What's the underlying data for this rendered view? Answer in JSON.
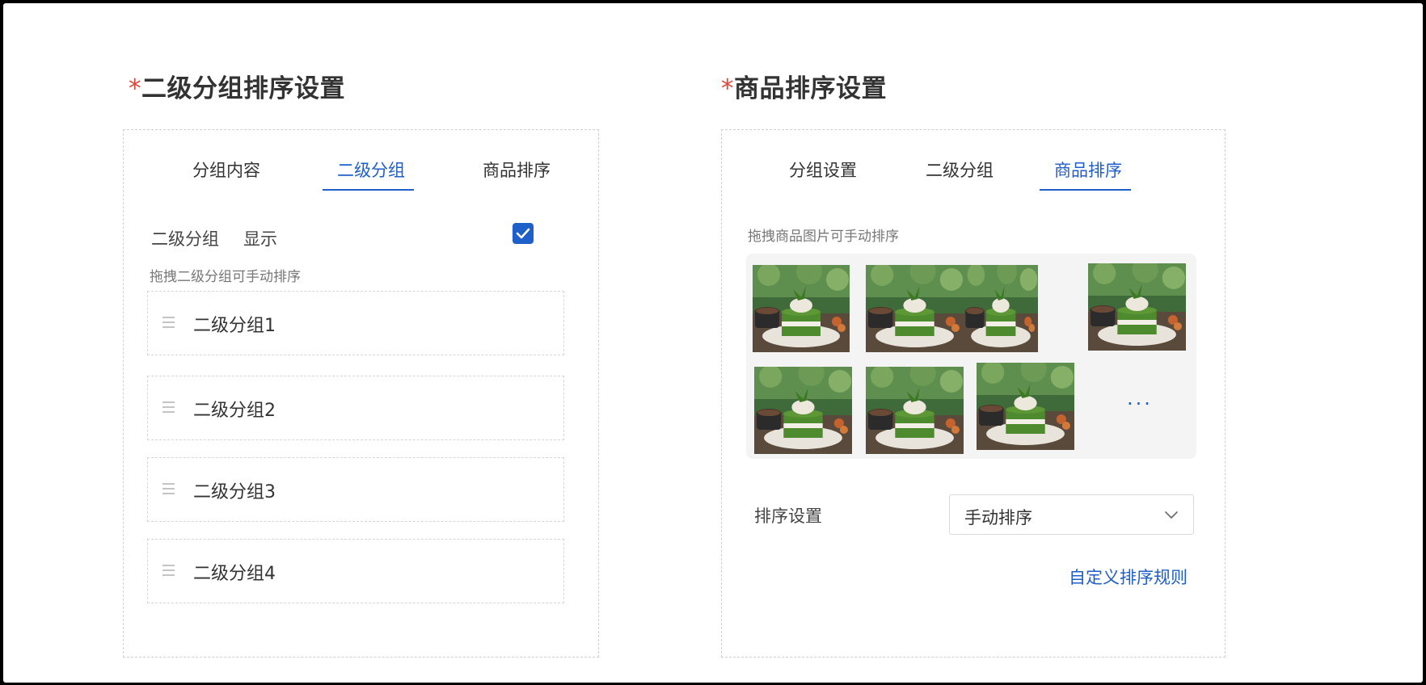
{
  "left_section": {
    "required_mark": "*",
    "title": "二级分组排序设置",
    "tabs": [
      {
        "label": "分组内容",
        "active": false
      },
      {
        "label": "二级分组",
        "active": true
      },
      {
        "label": "商品排序",
        "active": false
      }
    ],
    "display_row": {
      "group_label": "二级分组",
      "show_label": "显示",
      "checked": true
    },
    "hint": "拖拽二级分组可手动排序",
    "items": [
      "二级分组1",
      "二级分组2",
      "二级分组3",
      "二级分组4"
    ]
  },
  "right_section": {
    "required_mark": "*",
    "title": "商品排序设置",
    "tabs": [
      {
        "label": "分组设置",
        "active": false
      },
      {
        "label": "二级分组",
        "active": false
      },
      {
        "label": "商品排序",
        "active": true
      }
    ],
    "hint": "拖拽商品图片可手动排序",
    "more_label": "···",
    "sort_label": "排序设置",
    "sort_select": {
      "value": "手动排序"
    },
    "custom_rule_link": "自定义排序规则"
  },
  "colors": {
    "accent": "#1f5fc9",
    "required": "#e0473a"
  },
  "icons": {
    "checkbox": "check-icon",
    "drag": "drag-handle-icon",
    "dropdown": "chevron-down-icon"
  }
}
